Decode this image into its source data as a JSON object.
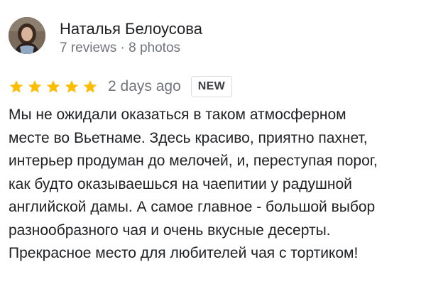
{
  "review": {
    "author": {
      "name": "Наталья Белоусова",
      "reviews": "7 reviews",
      "separator": "·",
      "photos": "8 photos"
    },
    "rating": 5,
    "rating_max": 5,
    "date": "2 days ago",
    "badge": "NEW",
    "text_lines": [
      "Мы не ожидали оказаться в таком атмосферном",
      "месте во Вьетнаме. Здесь красиво, приятно пахнет,",
      "интерьер продуман до мелочей, и, переступая порог,",
      "как будто оказываешься на чаепитии у радушной",
      "английской дамы. А самое главное - большой выбор",
      "разнообразного чая и очень вкусные десерты.",
      "Прекрасное место для любителей чая с тортиком!"
    ]
  },
  "colors": {
    "star": "#fbbc04",
    "secondary_text": "#70757a",
    "primary_text": "#202124",
    "badge_border": "#dadce0"
  },
  "icons": {
    "star": "star-icon",
    "avatar": "user-avatar-photo"
  }
}
